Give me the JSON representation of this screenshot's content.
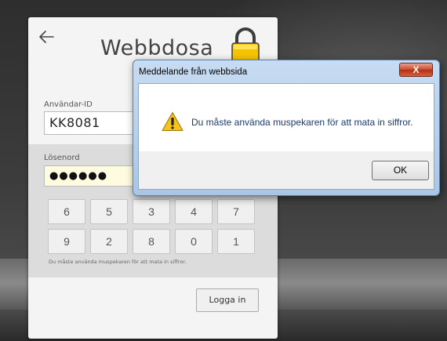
{
  "login": {
    "title": "Webbdosa",
    "user_id_label": "Användar-ID",
    "user_id_value": "KK8081",
    "password_label": "Lösenord",
    "password_value": "●●●●●●",
    "keypad": [
      "6",
      "5",
      "3",
      "4",
      "7",
      "9",
      "2",
      "8",
      "0",
      "1"
    ],
    "hint": "Du måste använda muspekaren för att mata in siffror.",
    "login_button": "Logga in"
  },
  "dialog": {
    "title": "Meddelande från webbsida",
    "close_label": "X",
    "message": "Du måste använda muspekaren för att mata in siffror.",
    "ok_label": "OK"
  },
  "icons": {
    "back": "back-arrow-icon",
    "lock": "padlock-icon",
    "warning": "warning-icon"
  },
  "colors": {
    "lock_gold": "#f5c400",
    "warning_yellow": "#f7c21a",
    "dialog_frame": "#aac6e6",
    "close_red": "#c74a2c"
  }
}
